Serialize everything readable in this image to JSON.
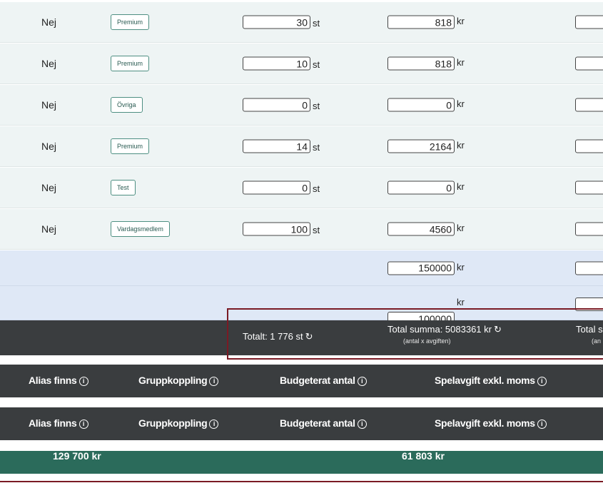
{
  "rows": [
    {
      "alias": "Nej",
      "group": "Premium",
      "qty": "30",
      "qty_unit": "st",
      "fee": "818",
      "fee_unit": "kr"
    },
    {
      "alias": "Nej",
      "group": "Premium",
      "qty": "10",
      "qty_unit": "st",
      "fee": "818",
      "fee_unit": "kr"
    },
    {
      "alias": "Nej",
      "group": "Övriga",
      "qty": "0",
      "qty_unit": "st",
      "fee": "0",
      "fee_unit": "kr"
    },
    {
      "alias": "Nej",
      "group": "Premium",
      "qty": "14",
      "qty_unit": "st",
      "fee": "2164",
      "fee_unit": "kr"
    },
    {
      "alias": "Nej",
      "group": "Test",
      "qty": "0",
      "qty_unit": "st",
      "fee": "0",
      "fee_unit": "kr"
    },
    {
      "alias": "Nej",
      "group": "Vardagsmedlem",
      "qty": "100",
      "qty_unit": "st",
      "fee": "4560",
      "fee_unit": "kr"
    }
  ],
  "extra_rows": [
    {
      "fee": "150000",
      "fee_unit": "kr"
    },
    {
      "fee": "100000",
      "fee_unit": "kr"
    }
  ],
  "totals": {
    "count": "Totalt: 1 776 st",
    "sum": "Total summa: 5083361 kr",
    "sum_note": "(antal x avgiften)",
    "cut_label": "Total s",
    "cut_note": "(an"
  },
  "header": {
    "alias": "Alias finns",
    "group": "Gruppkoppling",
    "budget": "Budgeterat antal",
    "fee": "Spelavgift exkl. moms"
  },
  "footer": {
    "value1": "129 700 kr",
    "value2": "61 803 kr"
  },
  "icons": {
    "info": "i",
    "refresh": "↻"
  },
  "colors": {
    "row_bg": "#eef4f4",
    "blue_row_bg": "#dfe8f6",
    "dark_bar": "#3a3d3f",
    "green_bar": "#2b6b5b",
    "highlight": "#7a1a24"
  }
}
